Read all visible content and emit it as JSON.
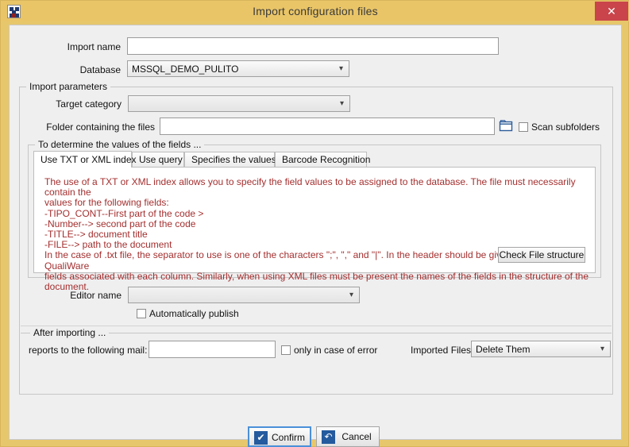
{
  "window": {
    "title": "Import configuration files",
    "icon": "app-tiles-icon",
    "close_label": "✕",
    "frame_color": "#e7c76b",
    "titlebar_color": "#e9c568",
    "close_color": "#c9454b"
  },
  "form": {
    "import_name_label": "Import name",
    "import_name_value": "",
    "import_name_placeholder": "",
    "database_label": "Database",
    "database_value": "MSSQL_DEMO_PULITO"
  },
  "import_parameters": {
    "caption": "Import parameters",
    "target_category_label": "Target category",
    "target_category_value": "",
    "folder_label": "Folder containing the files",
    "folder_value": "",
    "folder_placeholder": "",
    "browse_icon": "folder-icon",
    "scan_subfolders_label": "Scan subfolders",
    "scan_subfolders_checked": false
  },
  "fields_group": {
    "caption": "To determine the values of the fields ...",
    "tabs": [
      {
        "label": "Use TXT or XML index",
        "active": true
      },
      {
        "label": "Use query",
        "active": false
      },
      {
        "label": "Specifies the values",
        "active": false
      },
      {
        "label": "Barcode Recognition",
        "active": false
      }
    ],
    "description": "The use of a TXT or XML index allows you to specify the field values to be assigned to the database. The file must necessarily contain the\nvalues for the following fields:\n-TIPO_CONT--First part of the code >\n-Number--> second part of the code\n-TITLE--> document title\n-FILE--> path to the document\nIn the case of .txt file, the separator to use is one of the characters \";\", \",\" and \"|\". In the header should be given the names of the QualiWare\nfields associated with each column. Similarly, when using XML files must be present the names of the fields in the structure of the document.",
    "description_color": "#a42f2f",
    "check_button_label": "Check File structure"
  },
  "editor": {
    "editor_name_label": "Editor name",
    "editor_name_value": "",
    "auto_publish_label": "Automatically publish",
    "auto_publish_checked": false
  },
  "after_importing": {
    "caption": "After importing ...",
    "mail_label": "reports to the following mail:",
    "mail_value": "",
    "mail_placeholder": "",
    "only_error_label": "only in case of error",
    "only_error_checked": false,
    "imported_files_label": "Imported Files:",
    "imported_files_value": "Delete Them"
  },
  "actions": {
    "confirm_label": "Confirm",
    "confirm_icon": "check-icon",
    "confirm_glyph": "✔",
    "cancel_label": "Cancel",
    "cancel_icon": "undo-arrow-icon",
    "cancel_glyph": "↶"
  }
}
